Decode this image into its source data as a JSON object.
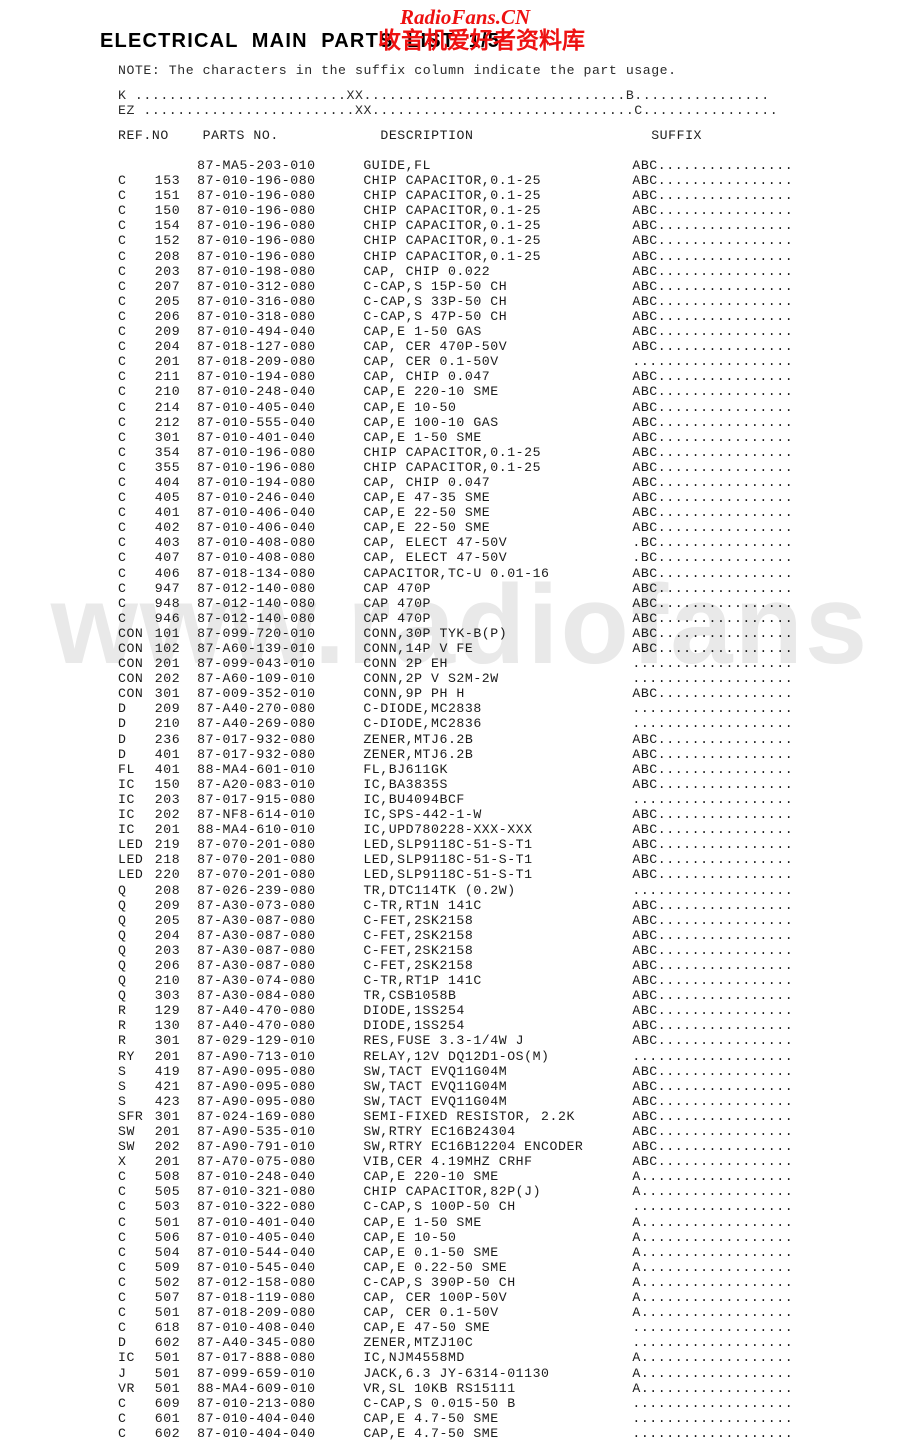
{
  "watermarks": {
    "diagonal_text": "www.radiofans",
    "red_latin": "RadioFans.CN",
    "red_cjk": "收音机爱好者资料库",
    "red_color": "#ee1111",
    "diagonal_color": "#e9e9e9"
  },
  "document": {
    "title": "ELECTRICAL  MAIN  PARTS  LIST  1/5",
    "note": "NOTE: The characters in the suffix column indicate the part usage.",
    "legend": [
      "K .........................XX...............................B................",
      "EZ .........................XX...............................C................"
    ],
    "column_headers": "REF.NO    PARTS NO.            DESCRIPTION                     SUFFIX"
  },
  "table": {
    "columns": [
      "REF.NO",
      "PARTS NO.",
      "DESCRIPTION",
      "SUFFIX"
    ],
    "suffix_pad": "................",
    "rows": [
      {
        "ref": "",
        "num": "",
        "pn": "87-MA5-203-010",
        "desc": "GUIDE,FL",
        "suffix": "ABC"
      },
      {
        "ref": "C",
        "num": "153",
        "pn": "87-010-196-080",
        "desc": "CHIP CAPACITOR,0.1-25",
        "suffix": "ABC"
      },
      {
        "ref": "C",
        "num": "151",
        "pn": "87-010-196-080",
        "desc": "CHIP CAPACITOR,0.1-25",
        "suffix": "ABC"
      },
      {
        "ref": "C",
        "num": "150",
        "pn": "87-010-196-080",
        "desc": "CHIP CAPACITOR,0.1-25",
        "suffix": "ABC"
      },
      {
        "ref": "C",
        "num": "154",
        "pn": "87-010-196-080",
        "desc": "CHIP CAPACITOR,0.1-25",
        "suffix": "ABC"
      },
      {
        "ref": "C",
        "num": "152",
        "pn": "87-010-196-080",
        "desc": "CHIP CAPACITOR,0.1-25",
        "suffix": "ABC"
      },
      {
        "ref": "C",
        "num": "208",
        "pn": "87-010-196-080",
        "desc": "CHIP CAPACITOR,0.1-25",
        "suffix": "ABC"
      },
      {
        "ref": "C",
        "num": "203",
        "pn": "87-010-198-080",
        "desc": "CAP, CHIP 0.022",
        "suffix": "ABC"
      },
      {
        "ref": "C",
        "num": "207",
        "pn": "87-010-312-080",
        "desc": "C-CAP,S 15P-50 CH",
        "suffix": "ABC"
      },
      {
        "ref": "C",
        "num": "205",
        "pn": "87-010-316-080",
        "desc": "C-CAP,S 33P-50 CH",
        "suffix": "ABC"
      },
      {
        "ref": "C",
        "num": "206",
        "pn": "87-010-318-080",
        "desc": "C-CAP,S 47P-50 CH",
        "suffix": "ABC"
      },
      {
        "ref": "C",
        "num": "209",
        "pn": "87-010-494-040",
        "desc": "CAP,E 1-50 GAS",
        "suffix": "ABC"
      },
      {
        "ref": "C",
        "num": "204",
        "pn": "87-018-127-080",
        "desc": "CAP, CER 470P-50V",
        "suffix": "ABC"
      },
      {
        "ref": "C",
        "num": "201",
        "pn": "87-018-209-080",
        "desc": "CAP, CER 0.1-50V",
        "suffix": "..."
      },
      {
        "ref": "C",
        "num": "211",
        "pn": "87-010-194-080",
        "desc": "CAP, CHIP 0.047",
        "suffix": "ABC"
      },
      {
        "ref": "C",
        "num": "210",
        "pn": "87-010-248-040",
        "desc": "CAP,E 220-10 SME",
        "suffix": "ABC"
      },
      {
        "ref": "C",
        "num": "214",
        "pn": "87-010-405-040",
        "desc": "CAP,E 10-50",
        "suffix": "ABC"
      },
      {
        "ref": "C",
        "num": "212",
        "pn": "87-010-555-040",
        "desc": "CAP,E 100-10 GAS",
        "suffix": "ABC"
      },
      {
        "ref": "C",
        "num": "301",
        "pn": "87-010-401-040",
        "desc": "CAP,E 1-50 SME",
        "suffix": "ABC"
      },
      {
        "ref": "C",
        "num": "354",
        "pn": "87-010-196-080",
        "desc": "CHIP CAPACITOR,0.1-25",
        "suffix": "ABC"
      },
      {
        "ref": "C",
        "num": "355",
        "pn": "87-010-196-080",
        "desc": "CHIP CAPACITOR,0.1-25",
        "suffix": "ABC"
      },
      {
        "ref": "C",
        "num": "404",
        "pn": "87-010-194-080",
        "desc": "CAP, CHIP 0.047",
        "suffix": "ABC"
      },
      {
        "ref": "C",
        "num": "405",
        "pn": "87-010-246-040",
        "desc": "CAP,E 47-35 SME",
        "suffix": "ABC"
      },
      {
        "ref": "C",
        "num": "401",
        "pn": "87-010-406-040",
        "desc": "CAP,E 22-50 SME",
        "suffix": "ABC"
      },
      {
        "ref": "C",
        "num": "402",
        "pn": "87-010-406-040",
        "desc": "CAP,E 22-50 SME",
        "suffix": "ABC"
      },
      {
        "ref": "C",
        "num": "403",
        "pn": "87-010-408-080",
        "desc": "CAP, ELECT 47-50V",
        "suffix": ".BC"
      },
      {
        "ref": "C",
        "num": "407",
        "pn": "87-010-408-080",
        "desc": "CAP, ELECT 47-50V",
        "suffix": ".BC"
      },
      {
        "ref": "C",
        "num": "406",
        "pn": "87-018-134-080",
        "desc": "CAPACITOR,TC-U 0.01-16",
        "suffix": "ABC"
      },
      {
        "ref": "C",
        "num": "947",
        "pn": "87-012-140-080",
        "desc": "CAP 470P",
        "suffix": "ABC"
      },
      {
        "ref": "C",
        "num": "948",
        "pn": "87-012-140-080",
        "desc": "CAP 470P",
        "suffix": "ABC"
      },
      {
        "ref": "C",
        "num": "946",
        "pn": "87-012-140-080",
        "desc": "CAP 470P",
        "suffix": "ABC"
      },
      {
        "ref": "CON",
        "num": "101",
        "pn": "87-099-720-010",
        "desc": "CONN,30P TYK-B(P)",
        "suffix": "ABC"
      },
      {
        "ref": "CON",
        "num": "102",
        "pn": "87-A60-139-010",
        "desc": "CONN,14P V FE",
        "suffix": "ABC"
      },
      {
        "ref": "CON",
        "num": "201",
        "pn": "87-099-043-010",
        "desc": "CONN 2P EH",
        "suffix": "..."
      },
      {
        "ref": "CON",
        "num": "202",
        "pn": "87-A60-109-010",
        "desc": "CONN,2P V S2M-2W",
        "suffix": "..."
      },
      {
        "ref": "CON",
        "num": "301",
        "pn": "87-009-352-010",
        "desc": "CONN,9P PH H",
        "suffix": "ABC"
      },
      {
        "ref": "D",
        "num": "209",
        "pn": "87-A40-270-080",
        "desc": "C-DIODE,MC2838",
        "suffix": "..."
      },
      {
        "ref": "D",
        "num": "210",
        "pn": "87-A40-269-080",
        "desc": "C-DIODE,MC2836",
        "suffix": "..."
      },
      {
        "ref": "D",
        "num": "236",
        "pn": "87-017-932-080",
        "desc": "ZENER,MTJ6.2B",
        "suffix": "ABC"
      },
      {
        "ref": "D",
        "num": "401",
        "pn": "87-017-932-080",
        "desc": "ZENER,MTJ6.2B",
        "suffix": "ABC"
      },
      {
        "ref": "FL",
        "num": "401",
        "pn": "88-MA4-601-010",
        "desc": "FL,BJ611GK",
        "suffix": "ABC"
      },
      {
        "ref": "IC",
        "num": "150",
        "pn": "87-A20-083-010",
        "desc": "IC,BA3835S",
        "suffix": "ABC"
      },
      {
        "ref": "IC",
        "num": "203",
        "pn": "87-017-915-080",
        "desc": "IC,BU4094BCF",
        "suffix": "..."
      },
      {
        "ref": "IC",
        "num": "202",
        "pn": "87-NF8-614-010",
        "desc": "IC,SPS-442-1-W",
        "suffix": "ABC"
      },
      {
        "ref": "IC",
        "num": "201",
        "pn": "88-MA4-610-010",
        "desc": "IC,UPD780228-XXX-XXX",
        "suffix": "ABC"
      },
      {
        "ref": "LED",
        "num": "219",
        "pn": "87-070-201-080",
        "desc": "LED,SLP9118C-51-S-T1",
        "suffix": "ABC"
      },
      {
        "ref": "LED",
        "num": "218",
        "pn": "87-070-201-080",
        "desc": "LED,SLP9118C-51-S-T1",
        "suffix": "ABC"
      },
      {
        "ref": "LED",
        "num": "220",
        "pn": "87-070-201-080",
        "desc": "LED,SLP9118C-51-S-T1",
        "suffix": "ABC"
      },
      {
        "ref": "Q",
        "num": "208",
        "pn": "87-026-239-080",
        "desc": "TR,DTC114TK (0.2W)",
        "suffix": "..."
      },
      {
        "ref": "Q",
        "num": "209",
        "pn": "87-A30-073-080",
        "desc": "C-TR,RT1N 141C",
        "suffix": "ABC"
      },
      {
        "ref": "Q",
        "num": "205",
        "pn": "87-A30-087-080",
        "desc": "C-FET,2SK2158",
        "suffix": "ABC"
      },
      {
        "ref": "Q",
        "num": "204",
        "pn": "87-A30-087-080",
        "desc": "C-FET,2SK2158",
        "suffix": "ABC"
      },
      {
        "ref": "Q",
        "num": "203",
        "pn": "87-A30-087-080",
        "desc": "C-FET,2SK2158",
        "suffix": "ABC"
      },
      {
        "ref": "Q",
        "num": "206",
        "pn": "87-A30-087-080",
        "desc": "C-FET,2SK2158",
        "suffix": "ABC"
      },
      {
        "ref": "Q",
        "num": "210",
        "pn": "87-A30-074-080",
        "desc": "C-TR,RT1P 141C",
        "suffix": "ABC"
      },
      {
        "ref": "Q",
        "num": "303",
        "pn": "87-A30-084-080",
        "desc": "TR,CSB1058B",
        "suffix": "ABC"
      },
      {
        "ref": "R",
        "num": "129",
        "pn": "87-A40-470-080",
        "desc": "DIODE,1SS254",
        "suffix": "ABC"
      },
      {
        "ref": "R",
        "num": "130",
        "pn": "87-A40-470-080",
        "desc": "DIODE,1SS254",
        "suffix": "ABC"
      },
      {
        "ref": "R",
        "num": "301",
        "pn": "87-029-129-010",
        "desc": "RES,FUSE 3.3-1/4W J",
        "suffix": "ABC"
      },
      {
        "ref": "RY",
        "num": "201",
        "pn": "87-A90-713-010",
        "desc": "RELAY,12V DQ12D1-OS(M)",
        "suffix": "..."
      },
      {
        "ref": "S",
        "num": "419",
        "pn": "87-A90-095-080",
        "desc": "SW,TACT EVQ11G04M",
        "suffix": "ABC"
      },
      {
        "ref": "S",
        "num": "421",
        "pn": "87-A90-095-080",
        "desc": "SW,TACT EVQ11G04M",
        "suffix": "ABC"
      },
      {
        "ref": "S",
        "num": "423",
        "pn": "87-A90-095-080",
        "desc": "SW,TACT EVQ11G04M",
        "suffix": "ABC"
      },
      {
        "ref": "SFR",
        "num": "301",
        "pn": "87-024-169-080",
        "desc": "SEMI-FIXED RESISTOR, 2.2K",
        "suffix": "ABC"
      },
      {
        "ref": "SW",
        "num": "201",
        "pn": "87-A90-535-010",
        "desc": "SW,RTRY EC16B24304",
        "suffix": "ABC"
      },
      {
        "ref": "SW",
        "num": "202",
        "pn": "87-A90-791-010",
        "desc": "SW,RTRY EC16B12204 ENCODER",
        "suffix": "ABC"
      },
      {
        "ref": "X",
        "num": "201",
        "pn": "87-A70-075-080",
        "desc": "VIB,CER 4.19MHZ CRHF",
        "suffix": "ABC"
      },
      {
        "ref": "C",
        "num": "508",
        "pn": "87-010-248-040",
        "desc": "CAP,E 220-10 SME",
        "suffix": "A.."
      },
      {
        "ref": "C",
        "num": "505",
        "pn": "87-010-321-080",
        "desc": "CHIP CAPACITOR,82P(J)",
        "suffix": "A.."
      },
      {
        "ref": "C",
        "num": "503",
        "pn": "87-010-322-080",
        "desc": "C-CAP,S 100P-50 CH",
        "suffix": "..."
      },
      {
        "ref": "C",
        "num": "501",
        "pn": "87-010-401-040",
        "desc": "CAP,E 1-50 SME",
        "suffix": "A.."
      },
      {
        "ref": "C",
        "num": "506",
        "pn": "87-010-405-040",
        "desc": "CAP,E 10-50",
        "suffix": "A.."
      },
      {
        "ref": "C",
        "num": "504",
        "pn": "87-010-544-040",
        "desc": "CAP,E 0.1-50 SME",
        "suffix": "A.."
      },
      {
        "ref": "C",
        "num": "509",
        "pn": "87-010-545-040",
        "desc": "CAP,E 0.22-50 SME",
        "suffix": "A.."
      },
      {
        "ref": "C",
        "num": "502",
        "pn": "87-012-158-080",
        "desc": "C-CAP,S 390P-50 CH",
        "suffix": "A.."
      },
      {
        "ref": "C",
        "num": "507",
        "pn": "87-018-119-080",
        "desc": "CAP, CER 100P-50V",
        "suffix": "A.."
      },
      {
        "ref": "C",
        "num": "501",
        "pn": "87-018-209-080",
        "desc": "CAP, CER 0.1-50V",
        "suffix": "A.."
      },
      {
        "ref": "C",
        "num": "618",
        "pn": "87-010-408-040",
        "desc": "CAP,E 47-50 SME",
        "suffix": "..."
      },
      {
        "ref": "D",
        "num": "602",
        "pn": "87-A40-345-080",
        "desc": "ZENER,MTZJ10C",
        "suffix": "..."
      },
      {
        "ref": "IC",
        "num": "501",
        "pn": "87-017-888-080",
        "desc": "IC,NJM4558MD",
        "suffix": "A.."
      },
      {
        "ref": "J",
        "num": "501",
        "pn": "87-099-659-010",
        "desc": "JACK,6.3 JY-6314-01130",
        "suffix": "A.."
      },
      {
        "ref": "VR",
        "num": "501",
        "pn": "88-MA4-609-010",
        "desc": "VR,SL 10KB RS15111",
        "suffix": "A.."
      },
      {
        "ref": "C",
        "num": "609",
        "pn": "87-010-213-080",
        "desc": "C-CAP,S 0.015-50 B",
        "suffix": "..."
      },
      {
        "ref": "C",
        "num": "601",
        "pn": "87-010-404-040",
        "desc": "CAP,E 4.7-50 SME",
        "suffix": "..."
      },
      {
        "ref": "C",
        "num": "602",
        "pn": "87-010-404-040",
        "desc": "CAP,E 4.7-50 SME",
        "suffix": "..."
      }
    ]
  }
}
